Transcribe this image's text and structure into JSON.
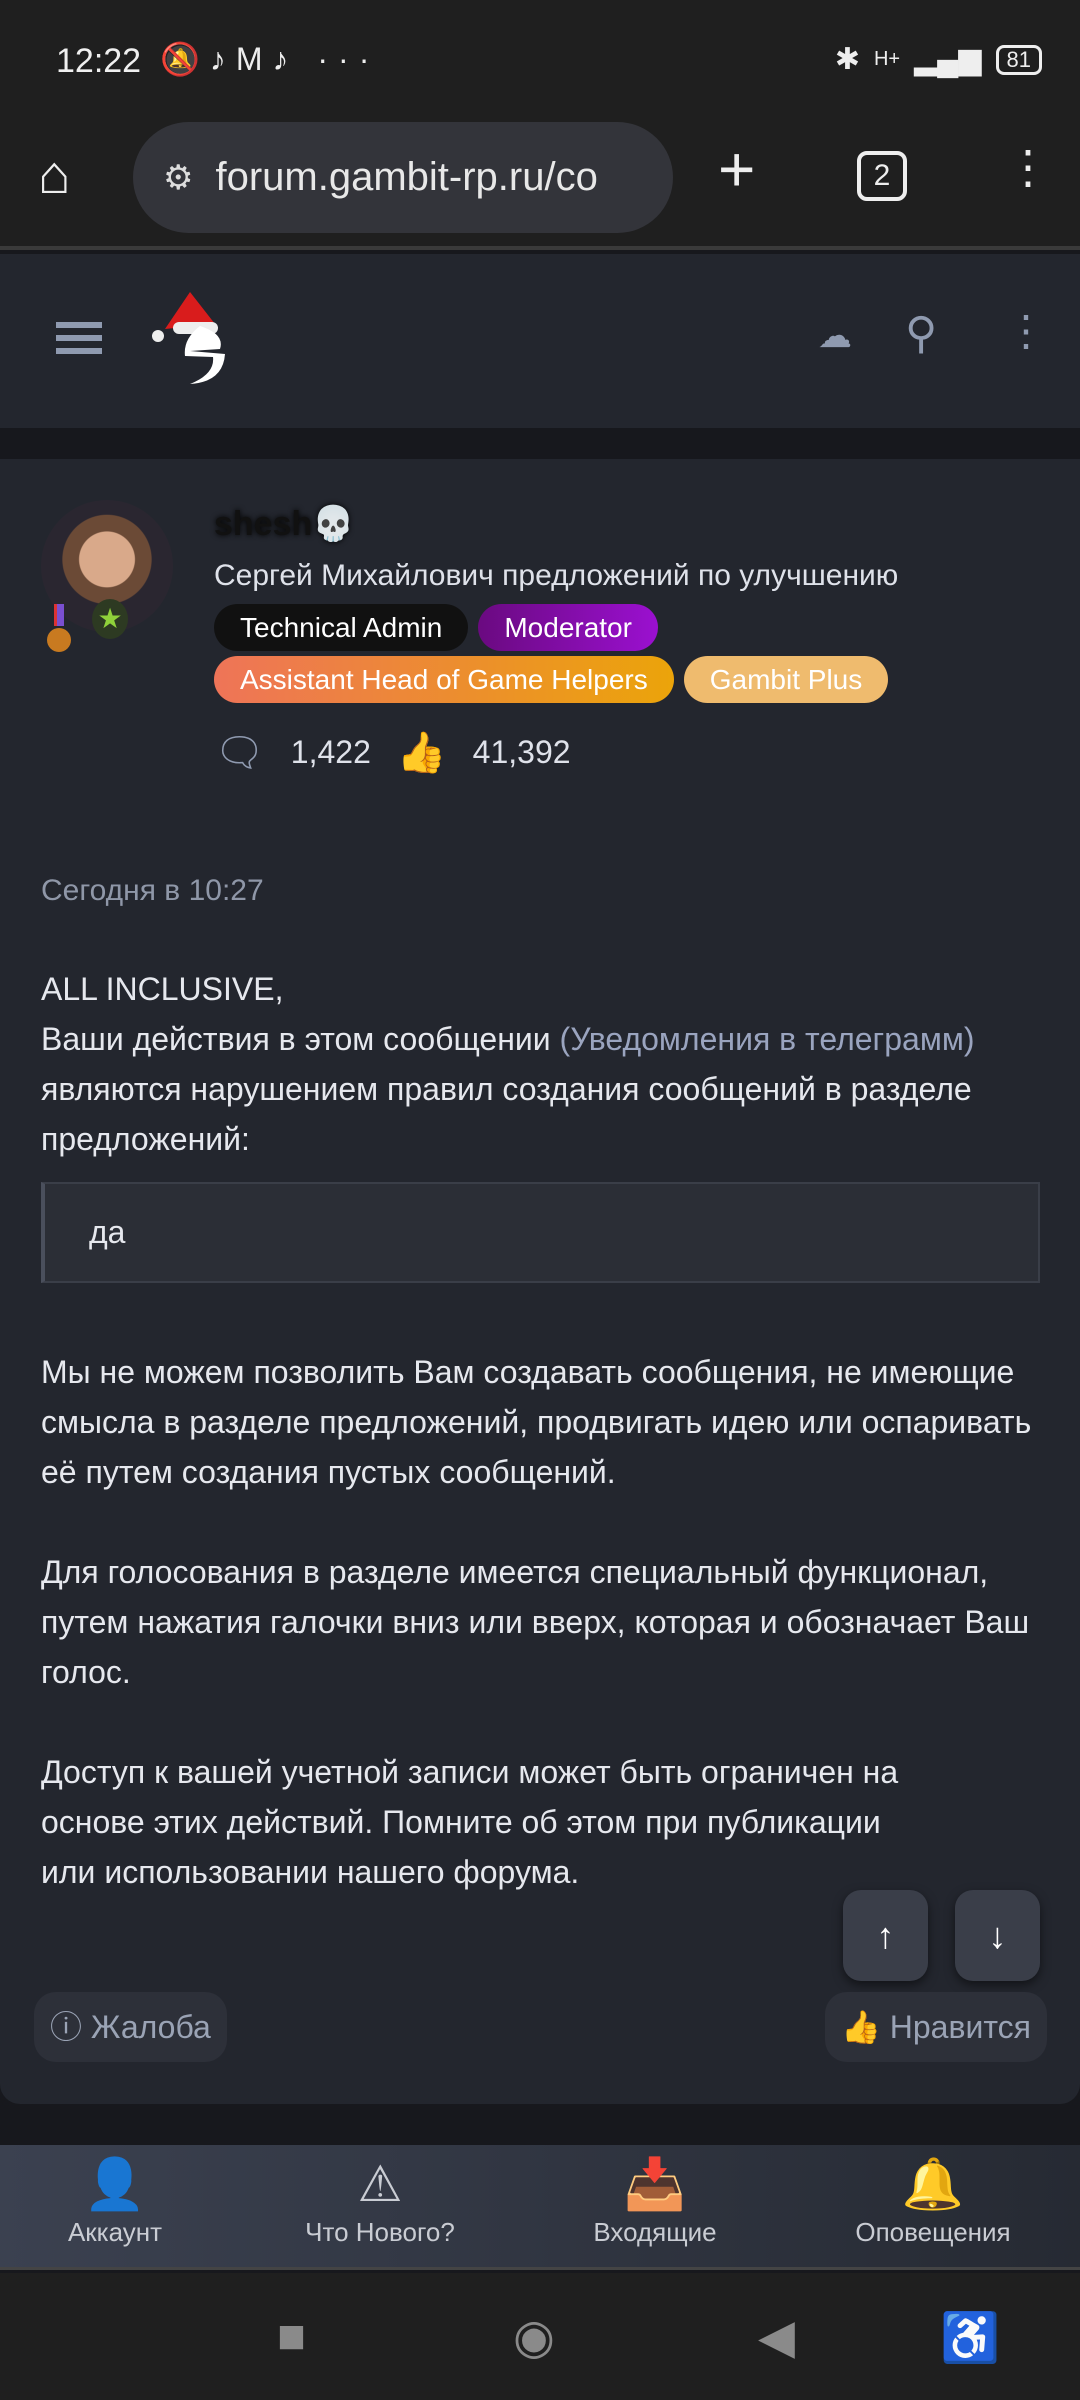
{
  "status": {
    "time": "12:22",
    "icons": [
      "mute-icon",
      "tiktok-icon",
      "gmail-icon",
      "tiktok-icon",
      "more-icon"
    ],
    "network": "H+",
    "battery": "81"
  },
  "browser": {
    "url": "forum.gambit-rp.ru/co",
    "tab_count": "2"
  },
  "post": {
    "username": "shesh💀",
    "user_title": "Сергей Михайлович предложений по улучшению",
    "badges": [
      {
        "label": "Technical Admin",
        "color": "#111111"
      },
      {
        "label": "Moderator",
        "color": "#8a0cc0"
      },
      {
        "label": "Assistant Head of Game Helpers",
        "color": "#f0a010"
      },
      {
        "label": "Gambit Plus",
        "color": "#efbb6e"
      }
    ],
    "messages": "1,422",
    "reactions": "41,392",
    "date": "Сегодня в 10:27",
    "greeting": "ALL INCLUSIVE,",
    "p1_before": "Ваши действия в этом сообщении ",
    "p1_link": "(Уведомления в телеграмм)",
    "p1_after": " являются нарушением правил создания сообщений в разделе предложений:",
    "quote": "да",
    "p2": "Мы не можем позволить Вам создавать сообщения, не имеющие смысла в разделе предложений, продвигать идею или оспаривать её путем создания пустых сообщений.",
    "p3": "Для голосования в разделе имеется специальный функционал, путем нажатия галочки вниз или вверх, которая и обозначает Ваш голос.",
    "p4": "Доступ к вашей учетной записи может быть ограничен на основе этих действий. Помните об этом при публикации или использовании нашего форума.",
    "report": "Жалоба",
    "like": "Нравится"
  },
  "bottom_nav": [
    {
      "label": "Аккаунт"
    },
    {
      "label": "Что Нового?"
    },
    {
      "label": "Входящие"
    },
    {
      "label": "Оповещения"
    }
  ]
}
